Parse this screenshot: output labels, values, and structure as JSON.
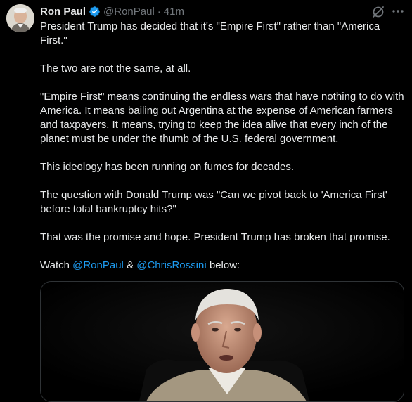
{
  "tweet": {
    "author_name": "Ron Paul",
    "handle": "@RonPaul",
    "separator": "·",
    "time": "41m",
    "paragraphs": [
      "President Trump has decided that it's \"Empire First\" rather than \"America First.\"",
      "The two are not the same, at all.",
      "\"Empire First\" means continuing the endless wars that have nothing to do with America. It means bailing out Argentina at the expense of American farmers and taxpayers. It means, trying to keep the idea alive that every inch of the planet must be under the thumb of the U.S. federal government.",
      "This ideology has been running on fumes for decades.",
      "The question with Donald Trump was \"Can we pivot back to 'America First' before total bankruptcy hits?\"",
      "That was the promise and hope. President Trump has broken that promise."
    ],
    "last_line": {
      "prefix": "Watch ",
      "mention1": "@RonPaul",
      "middle": " & ",
      "mention2": "@ChrisRossini",
      "suffix": " below:"
    }
  },
  "icons": {
    "verified": "verified-badge-icon",
    "grok": "grok-icon",
    "more": "more-options-icon"
  },
  "colors": {
    "background": "#000000",
    "text": "#e7e9ea",
    "muted": "#71767b",
    "link": "#1d9bf0",
    "verified": "#1d9bf0"
  }
}
